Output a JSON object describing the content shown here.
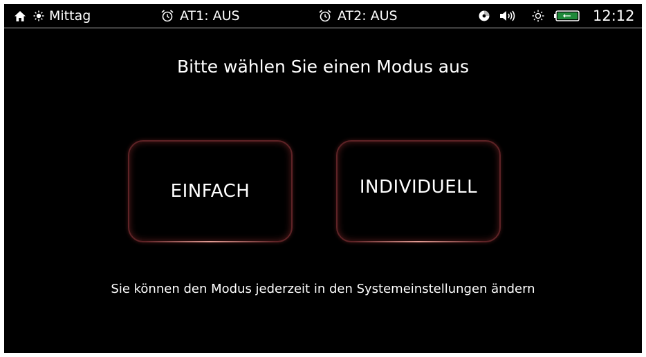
{
  "status_bar": {
    "time_of_day_icon": "sun-icon",
    "time_of_day": "Mittag",
    "alarm1": "AT1: AUS",
    "alarm2": "AT2: AUS",
    "icons": [
      "home-icon",
      "alarm-clock-icon",
      "cd-icon",
      "speaker-icon",
      "brightness-icon",
      "battery-icon"
    ],
    "clock": "12:12",
    "battery_color": "#1f8a3a"
  },
  "main": {
    "title": "Bitte wählen Sie einen Modus aus",
    "buttons": [
      {
        "label": "EINFACH"
      },
      {
        "label": "INDIVIDUELL"
      }
    ],
    "hint": "Sie können den Modus jederzeit in den Systemeinstellungen ändern"
  },
  "colors": {
    "background": "#000000",
    "text": "#ffffff",
    "button_border": "#7a2a2e"
  }
}
